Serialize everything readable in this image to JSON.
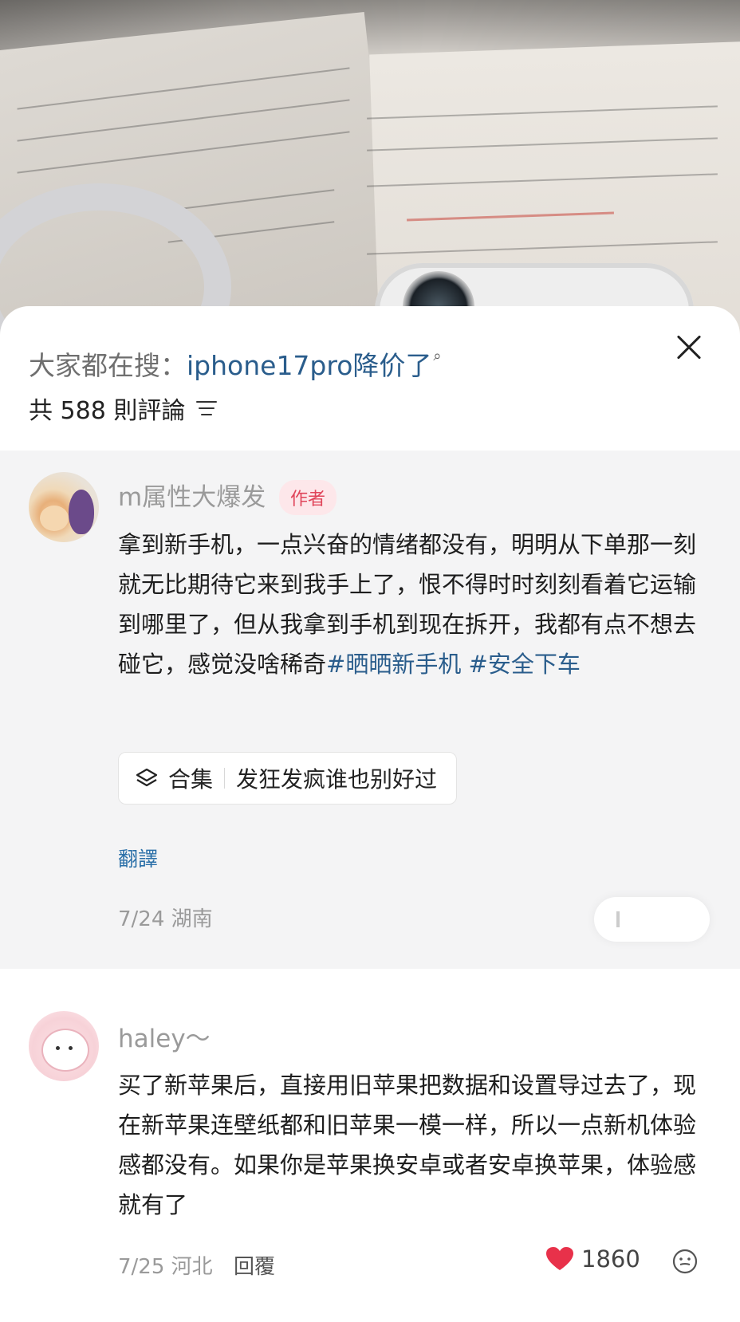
{
  "search_bar": {
    "prefix": "大家都在搜：",
    "keyword": "iphone17pro降价了"
  },
  "comments_header": {
    "count_text": "共 588 則評論"
  },
  "comments": [
    {
      "username": "m属性大爆发",
      "tag": "作者",
      "text_plain": "拿到新手机，一点兴奋的情绪都没有，明明从下单那一刻就无比期待它来到我手上了，恨不得时时刻刻看着它运输到哪里了，但从我拿到手机到现在拆开，我都有点不想去碰它，感觉没啥稀奇",
      "hashtags": [
        "#晒晒新手机",
        "#安全下车"
      ],
      "collection": {
        "label": "合集",
        "name": "发狂发疯谁也别好过"
      },
      "translate_label": "翻譯",
      "date": "7/24",
      "location": "湖南"
    },
    {
      "username": "haley～",
      "text": "买了新苹果后，直接用旧苹果把数据和设置导过去了，现在新苹果连壁纸都和旧苹果一模一样，所以一点新机体验感都没有。如果你是苹果换安卓或者安卓换苹果，体验感就有了",
      "date": "7/25",
      "location": "河北",
      "reply_label": "回覆",
      "likes": "1860"
    }
  ],
  "colors": {
    "link": "#2a5d8c",
    "author_tag_bg": "#fde7ea",
    "author_tag_text": "#e0455a",
    "like_heart": "#e8314a"
  }
}
